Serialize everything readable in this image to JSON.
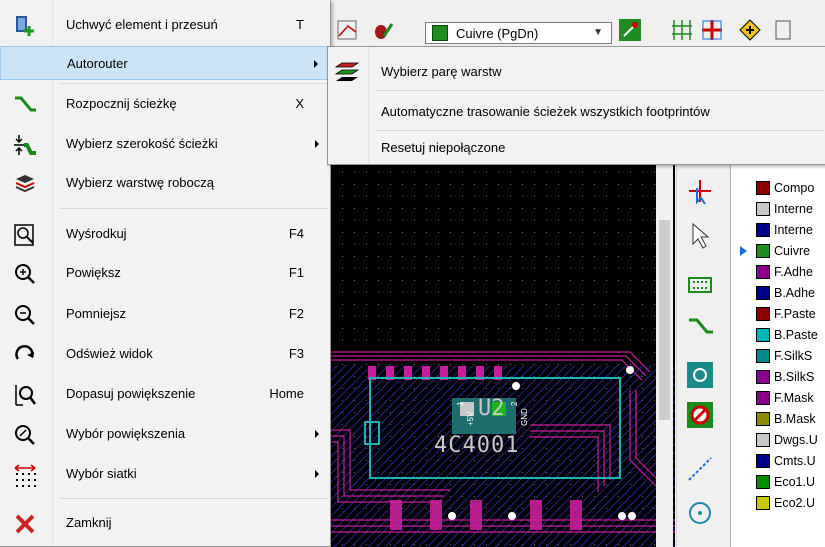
{
  "toolbar": {
    "layer_select": "Cuivre (PgDn)"
  },
  "main_menu": {
    "items": [
      {
        "label": "Uchwyć element i przesuń",
        "shortcut": "T"
      },
      {
        "label": "Autorouter",
        "shortcut": ""
      },
      {
        "label": "Rozpocznij ścieżkę",
        "shortcut": "X"
      },
      {
        "label": "Wybierz szerokość ścieżki",
        "shortcut": ""
      },
      {
        "label": "Wybierz warstwę roboczą",
        "shortcut": ""
      },
      {
        "label": "Wyśrodkuj",
        "shortcut": "F4"
      },
      {
        "label": "Powiększ",
        "shortcut": "F1"
      },
      {
        "label": "Pomniejsz",
        "shortcut": "F2"
      },
      {
        "label": "Odśwież widok",
        "shortcut": "F3"
      },
      {
        "label": "Dopasuj powiększenie",
        "shortcut": "Home"
      },
      {
        "label": "Wybór powiększenia",
        "shortcut": ""
      },
      {
        "label": "Wybór siatki",
        "shortcut": ""
      },
      {
        "label": "Zamknij",
        "shortcut": ""
      }
    ]
  },
  "sub_menu": {
    "items": [
      {
        "label": "Wybierz parę warstw"
      },
      {
        "label": "Automatyczne trasowanie ścieżek wszystkich footprintów"
      },
      {
        "label": "Resetuj niepołączone"
      }
    ]
  },
  "canvas": {
    "component_ref": "U2",
    "component_value": "4C4001",
    "pin_labels": [
      "1",
      "+5V",
      "2",
      "GND"
    ]
  },
  "layers": {
    "active_index": 3,
    "items": [
      {
        "name": "Compo",
        "color": "#8b0000"
      },
      {
        "name": "Interne",
        "color": "#c8c8c8"
      },
      {
        "name": "Interne",
        "color": "#00008b"
      },
      {
        "name": "Cuivre",
        "color": "#1e8c1e"
      },
      {
        "name": "F.Adhe",
        "color": "#8b008b"
      },
      {
        "name": "B.Adhe",
        "color": "#00008b"
      },
      {
        "name": "F.Paste",
        "color": "#8b0000"
      },
      {
        "name": "B.Paste",
        "color": "#00b4b4"
      },
      {
        "name": "F.SilkS",
        "color": "#008b8b"
      },
      {
        "name": "B.SilkS",
        "color": "#8b008b"
      },
      {
        "name": "F.Mask",
        "color": "#8b008b"
      },
      {
        "name": "B.Mask",
        "color": "#8b8b00"
      },
      {
        "name": "Dwgs.U",
        "color": "#c8c8c8"
      },
      {
        "name": "Cmts.U",
        "color": "#00008b"
      },
      {
        "name": "Eco1.U",
        "color": "#008b00"
      },
      {
        "name": "Eco2.U",
        "color": "#c8c800"
      }
    ]
  },
  "colors": {
    "menu_highlight": "#cce4f7",
    "canvas_bg": "#000000",
    "copper_back": "#2a2aa0",
    "copper_front": "#c81e9b",
    "silkscreen": "#1eb4b4"
  }
}
